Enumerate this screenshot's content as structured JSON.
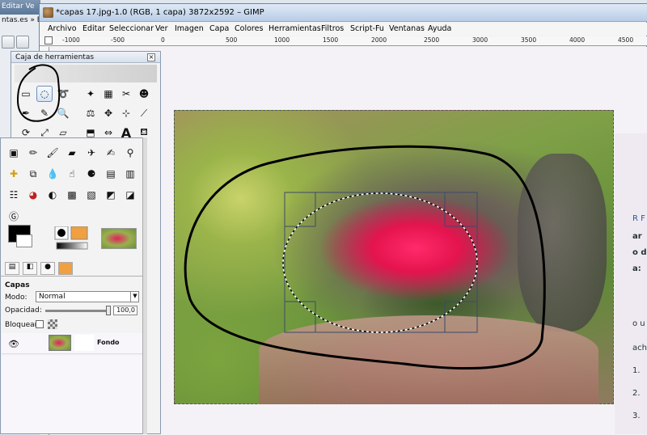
{
  "background_window": {
    "menu_fragment": "Editar Ve",
    "tab_fragment": "ntas.es » Ed"
  },
  "gimp": {
    "title": "*capas 17.jpg-1.0 (RGB, 1 capa) 3872x2592 – GIMP",
    "menu": [
      "Archivo",
      "Editar",
      "Seleccionar",
      "Ver",
      "Imagen",
      "Capa",
      "Colores",
      "Herramientas",
      "Filtros",
      "Script-Fu",
      "Ventanas",
      "Ayuda"
    ],
    "ruler_ticks": [
      "-1000",
      "-500",
      "0",
      "500",
      "1000",
      "1500",
      "2000",
      "2500",
      "3000",
      "3500",
      "4000",
      "4500"
    ]
  },
  "toolbox": {
    "title": "Caja de herramientas",
    "close": "×"
  },
  "layers": {
    "header": "Capas",
    "mode_label": "Modo:",
    "mode_value": "Normal",
    "opacity_label": "Opacidad:",
    "opacity_value": "100,0",
    "lock_label": "Bloquear:",
    "layer_name": "Fondo"
  },
  "right_page": {
    "fragments": [
      "R F",
      "ar",
      "o d",
      "a:",
      "o u",
      "ach",
      "1.",
      "2.",
      "3."
    ]
  },
  "colors": {
    "fg": "#000000",
    "bg": "#ffffff",
    "accent": "#6f8fb8"
  }
}
